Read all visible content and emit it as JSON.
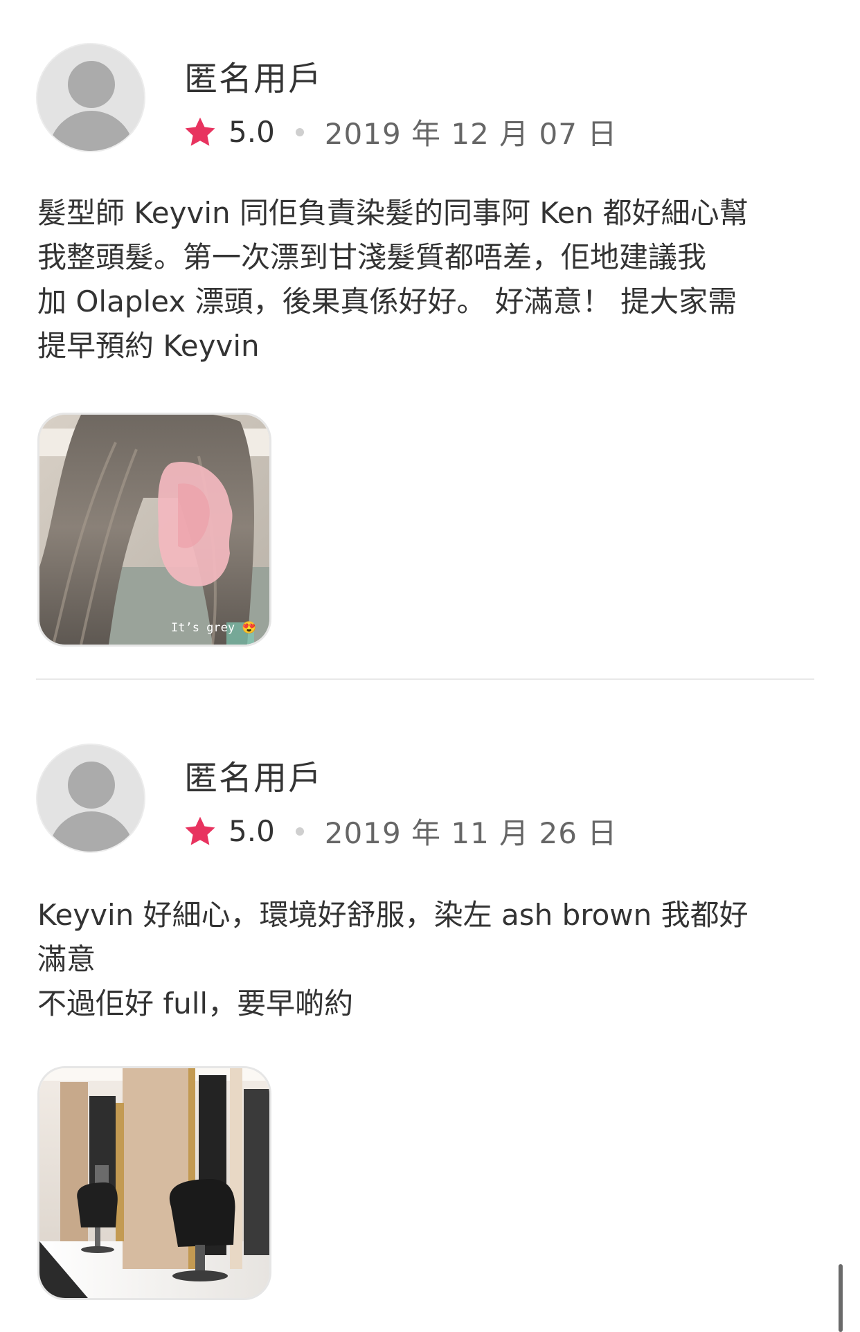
{
  "reviews": [
    {
      "username": "匿名用戶",
      "rating": "5.0",
      "date": "2019 年 12 月 07 日",
      "text": "髮型師 Keyvin 同佢負責染髮的同事阿 Ken 都好細心幫\n我整頭髮。第一次漂到甘淺髮質都唔差，佢地建議我\n加 Olaplex 漂頭，後果真係好好。 好滿意！ 提大家需\n提早預約 Keyvin",
      "photo_caption": "It’s grey 😍"
    },
    {
      "username": "匿名用戶",
      "rating": "5.0",
      "date": "2019 年 11 月 26 日",
      "text": "Keyvin 好細心，環境好舒服，染左 ash brown 我都好\n滿意\n不過佢好 full，要早啲約"
    }
  ],
  "colors": {
    "star": "#e8335f",
    "avatar_bg": "#e3e3e3",
    "avatar_fg": "#ababab",
    "divider": "#e8e8e8"
  },
  "icons": {
    "star": "star-icon",
    "avatar": "user-avatar-icon"
  }
}
